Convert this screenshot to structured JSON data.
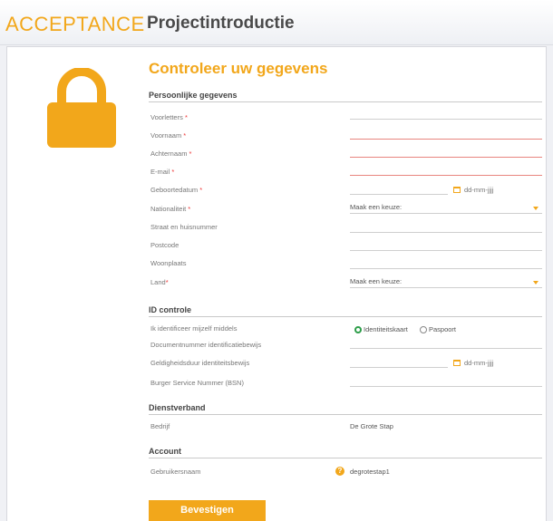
{
  "header": {
    "brand": "ACCEPTANCE",
    "title": "Projectintroductie"
  },
  "form": {
    "title": "Controleer uw gegevens",
    "submit_label": "Bevestigen"
  },
  "personal": {
    "heading": "Persoonlijke gegevens",
    "voorletters": "Voorletters",
    "voornaam": "Voornaam",
    "achternaam": "Achternaam",
    "email": "E-mail",
    "geboortedatum": "Geboortedatum",
    "nationaliteit": "Nationaliteit",
    "straat": "Straat en huisnummer",
    "postcode": "Postcode",
    "woonplaats": "Woonplaats",
    "land": "Land",
    "required_mark": "*",
    "date_hint": "dd-mm-jjjj",
    "nationaliteit_value": "Maak een keuze:",
    "land_value": "Maak een keuze:"
  },
  "id_control": {
    "heading": "ID controle",
    "identify_label": "Ik identificeer mijzelf middels",
    "option_id": "Identiteitskaart",
    "option_passport": "Paspoort",
    "selected": "Identiteitskaart",
    "doc_number": "Documentnummer identificatiebewijs",
    "validity": "Geldigheidsduur identiteitsbewijs",
    "bsn": "Burger Service Nummer (BSN)",
    "date_hint": "dd-mm-jjjj"
  },
  "employment": {
    "heading": "Dienstverband",
    "company_label": "Bedrijf",
    "company_value": "De Grote Stap"
  },
  "account": {
    "heading": "Account",
    "username_label": "Gebruikersnaam",
    "username_value": "degrotestap1",
    "help_icon": "?"
  },
  "colors": {
    "accent": "#f2a71b",
    "error_underline": "#e8857f",
    "radio_selected": "#2e9e4a",
    "required": "#e33333"
  },
  "icons": {
    "hero": "lock-icon",
    "date": "calendar-icon",
    "dropdown": "chevron-down-icon",
    "help": "help-icon"
  }
}
